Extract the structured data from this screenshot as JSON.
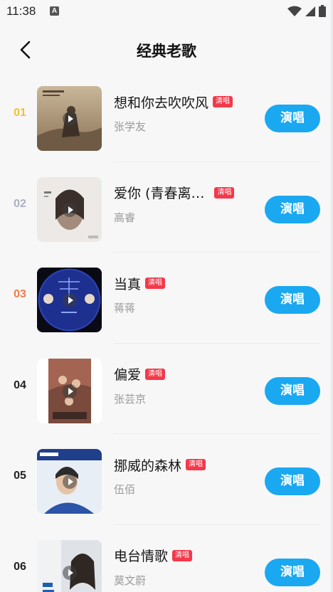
{
  "status_bar": {
    "time": "11:38",
    "keyboard_indicator": "A"
  },
  "header": {
    "title": "经典老歌",
    "back_icon": "chevron-left-icon"
  },
  "colors": {
    "rank_1": "#f2bf3b",
    "rank_2": "#aab0c4",
    "rank_3": "#f07a4e",
    "rank_default": "#222222",
    "sing_button": "#1aa8f1",
    "tag": "#f3394a"
  },
  "songs": [
    {
      "rank": "01",
      "title": "想和你去吹吹风",
      "tag": "清唱",
      "artist": "张学友",
      "action": "演唱"
    },
    {
      "rank": "02",
      "title": "爱你 (青春离…",
      "tag": "清唱",
      "artist": "高睿",
      "action": "演唱"
    },
    {
      "rank": "03",
      "title": "当真",
      "tag": "清唱",
      "artist": "蒋蒋",
      "action": "演唱"
    },
    {
      "rank": "04",
      "title": "偏爱",
      "tag": "清唱",
      "artist": "张芸京",
      "action": "演唱"
    },
    {
      "rank": "05",
      "title": "挪威的森林",
      "tag": "清唱",
      "artist": "伍佰",
      "action": "演唱"
    },
    {
      "rank": "06",
      "title": "电台情歌",
      "tag": "清唱",
      "artist": "莫文蔚",
      "action": "演唱"
    }
  ]
}
